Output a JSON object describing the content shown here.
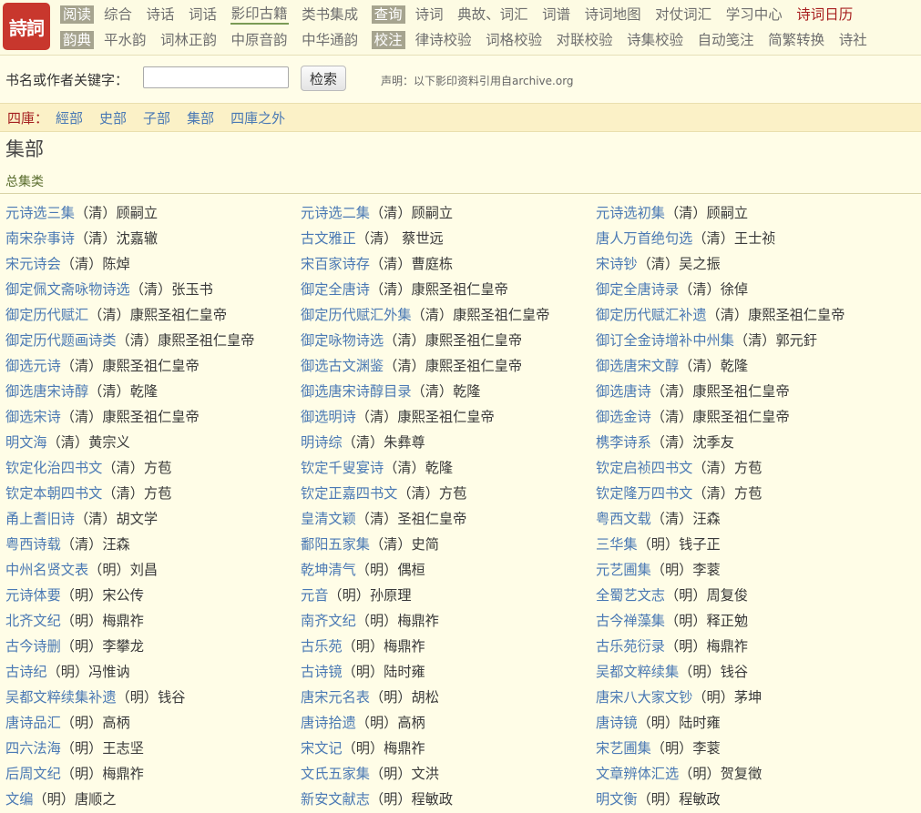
{
  "logo": {
    "text": "詩詞"
  },
  "nav": {
    "row1": [
      {
        "label": "阅读",
        "type": "category"
      },
      {
        "label": "综合",
        "type": "link"
      },
      {
        "label": "诗话",
        "type": "link"
      },
      {
        "label": "词话",
        "type": "link"
      },
      {
        "label": "影印古籍",
        "type": "active"
      },
      {
        "label": "类书集成",
        "type": "link"
      },
      {
        "label": "查询",
        "type": "category"
      },
      {
        "label": "诗词",
        "type": "link"
      },
      {
        "label": "典故、词汇",
        "type": "link"
      },
      {
        "label": "词谱",
        "type": "link"
      },
      {
        "label": "诗词地图",
        "type": "link"
      },
      {
        "label": "对仗词汇",
        "type": "link"
      },
      {
        "label": "学习中心",
        "type": "link"
      },
      {
        "label": "诗词日历",
        "type": "highlight"
      }
    ],
    "row2": [
      {
        "label": "韵典",
        "type": "category"
      },
      {
        "label": "平水韵",
        "type": "link"
      },
      {
        "label": "词林正韵",
        "type": "link"
      },
      {
        "label": "中原音韵",
        "type": "link"
      },
      {
        "label": "中华通韵",
        "type": "link"
      },
      {
        "label": "校注",
        "type": "category"
      },
      {
        "label": "律诗校验",
        "type": "link"
      },
      {
        "label": "词格校验",
        "type": "link"
      },
      {
        "label": "对联校验",
        "type": "link"
      },
      {
        "label": "诗集校验",
        "type": "link"
      },
      {
        "label": "自动笺注",
        "type": "link"
      },
      {
        "label": "简繁转换",
        "type": "link"
      },
      {
        "label": "诗社",
        "type": "link"
      }
    ]
  },
  "search": {
    "label": "书名或作者关键字：",
    "value": "",
    "placeholder": "",
    "button": "检索",
    "notice": "声明：以下影印资料引用自archive.org"
  },
  "siku": {
    "label": "四庫：",
    "links": [
      "經部",
      "史部",
      "子部",
      "集部",
      "四庫之外"
    ]
  },
  "section": {
    "title": "集部",
    "subtitle": "总集类"
  },
  "books": [
    {
      "title": "元诗选三集",
      "author": "（清）顾嗣立"
    },
    {
      "title": "元诗选二集",
      "author": "（清）顾嗣立"
    },
    {
      "title": "元诗选初集",
      "author": "（清）顾嗣立"
    },
    {
      "title": "南宋杂事诗",
      "author": "（清）沈嘉辙"
    },
    {
      "title": "古文雅正",
      "author": "（清） 蔡世远"
    },
    {
      "title": "唐人万首绝句选",
      "author": "（清）王士祯"
    },
    {
      "title": "宋元诗会",
      "author": "（清）陈焯"
    },
    {
      "title": "宋百家诗存",
      "author": "（清）曹庭栋"
    },
    {
      "title": "宋诗钞",
      "author": "（清）吴之振"
    },
    {
      "title": "御定佩文斋咏物诗选",
      "author": "（清）张玉书"
    },
    {
      "title": "御定全唐诗",
      "author": "（清）康熙圣祖仁皇帝"
    },
    {
      "title": "御定全唐诗录",
      "author": "（清）徐倬"
    },
    {
      "title": "御定历代赋汇",
      "author": "（清）康熙圣祖仁皇帝"
    },
    {
      "title": "御定历代赋汇外集",
      "author": "（清）康熙圣祖仁皇帝"
    },
    {
      "title": "御定历代赋汇补遗",
      "author": "（清）康熙圣祖仁皇帝"
    },
    {
      "title": "御定历代题画诗类",
      "author": "（清）康熙圣祖仁皇帝"
    },
    {
      "title": "御定咏物诗选",
      "author": "（清）康熙圣祖仁皇帝"
    },
    {
      "title": "御订全金诗增补中州集",
      "author": "（清）郭元釪"
    },
    {
      "title": "御选元诗",
      "author": "（清）康熙圣祖仁皇帝"
    },
    {
      "title": "御选古文渊鉴",
      "author": "（清）康熙圣祖仁皇帝"
    },
    {
      "title": "御选唐宋文醇",
      "author": "（清）乾隆"
    },
    {
      "title": "御选唐宋诗醇",
      "author": "（清）乾隆"
    },
    {
      "title": "御选唐宋诗醇目录",
      "author": "（清）乾隆"
    },
    {
      "title": "御选唐诗",
      "author": "（清）康熙圣祖仁皇帝"
    },
    {
      "title": "御选宋诗",
      "author": "（清）康熙圣祖仁皇帝"
    },
    {
      "title": "御选明诗",
      "author": "（清）康熙圣祖仁皇帝"
    },
    {
      "title": "御选金诗",
      "author": "（清）康熙圣祖仁皇帝"
    },
    {
      "title": "明文海",
      "author": "（清）黄宗义"
    },
    {
      "title": "明诗综",
      "author": "（清）朱彝尊"
    },
    {
      "title": "槜李诗系",
      "author": "（清）沈季友"
    },
    {
      "title": "钦定化治四书文",
      "author": "（清）方苞"
    },
    {
      "title": "钦定千叟宴诗",
      "author": "（清）乾隆"
    },
    {
      "title": "钦定启祯四书文",
      "author": "（清）方苞"
    },
    {
      "title": "钦定本朝四书文",
      "author": "（清）方苞"
    },
    {
      "title": "钦定正嘉四书文",
      "author": "（清）方苞"
    },
    {
      "title": "钦定隆万四书文",
      "author": "（清）方苞"
    },
    {
      "title": "甬上耆旧诗",
      "author": "（清）胡文学"
    },
    {
      "title": "皇清文颖",
      "author": "（清）圣祖仁皇帝"
    },
    {
      "title": "粤西文载",
      "author": "（清）汪森"
    },
    {
      "title": "粤西诗载",
      "author": "（清）汪森"
    },
    {
      "title": "鄱阳五家集",
      "author": "（清）史简"
    },
    {
      "title": "三华集",
      "author": "（明）钱子正"
    },
    {
      "title": "中州名贤文表",
      "author": "（明）刘昌"
    },
    {
      "title": "乾坤清气",
      "author": "（明）偶桓"
    },
    {
      "title": "元艺圃集",
      "author": "（明）李蓘"
    },
    {
      "title": "元诗体要",
      "author": "（明）宋公传"
    },
    {
      "title": "元音",
      "author": "（明）孙原理"
    },
    {
      "title": "全蜀艺文志",
      "author": "（明）周复俊"
    },
    {
      "title": "北齐文纪",
      "author": "（明）梅鼎祚"
    },
    {
      "title": "南齐文纪",
      "author": "（明）梅鼎祚"
    },
    {
      "title": "古今禅藻集",
      "author": "（明）释正勉"
    },
    {
      "title": "古今诗删",
      "author": "（明）李攀龙"
    },
    {
      "title": "古乐苑",
      "author": "（明）梅鼎祚"
    },
    {
      "title": "古乐苑衍录",
      "author": "（明）梅鼎祚"
    },
    {
      "title": "古诗纪",
      "author": "（明）冯惟讷"
    },
    {
      "title": "古诗镜",
      "author": "（明）陆时雍"
    },
    {
      "title": "吴都文粹续集",
      "author": "（明）钱谷"
    },
    {
      "title": "吴都文粹续集补遗",
      "author": "（明）钱谷"
    },
    {
      "title": "唐宋元名表",
      "author": "（明）胡松"
    },
    {
      "title": "唐宋八大家文钞",
      "author": "（明）茅坤"
    },
    {
      "title": "唐诗品汇",
      "author": "（明）高柄"
    },
    {
      "title": "唐诗拾遗",
      "author": "（明）高柄"
    },
    {
      "title": "唐诗镜",
      "author": "（明）陆时雍"
    },
    {
      "title": "四六法海",
      "author": "（明）王志坚"
    },
    {
      "title": "宋文记",
      "author": "（明）梅鼎祚"
    },
    {
      "title": "宋艺圃集",
      "author": "（明）李蓘"
    },
    {
      "title": "后周文纪",
      "author": "（明）梅鼎祚"
    },
    {
      "title": "文氏五家集",
      "author": "（明）文洪"
    },
    {
      "title": "文章辨体汇选",
      "author": "（明）贺复徵"
    },
    {
      "title": "文编",
      "author": "（明）唐顺之"
    },
    {
      "title": "新安文献志",
      "author": "（明）程敏政"
    },
    {
      "title": "明文衡",
      "author": "（明）程敏政"
    }
  ]
}
